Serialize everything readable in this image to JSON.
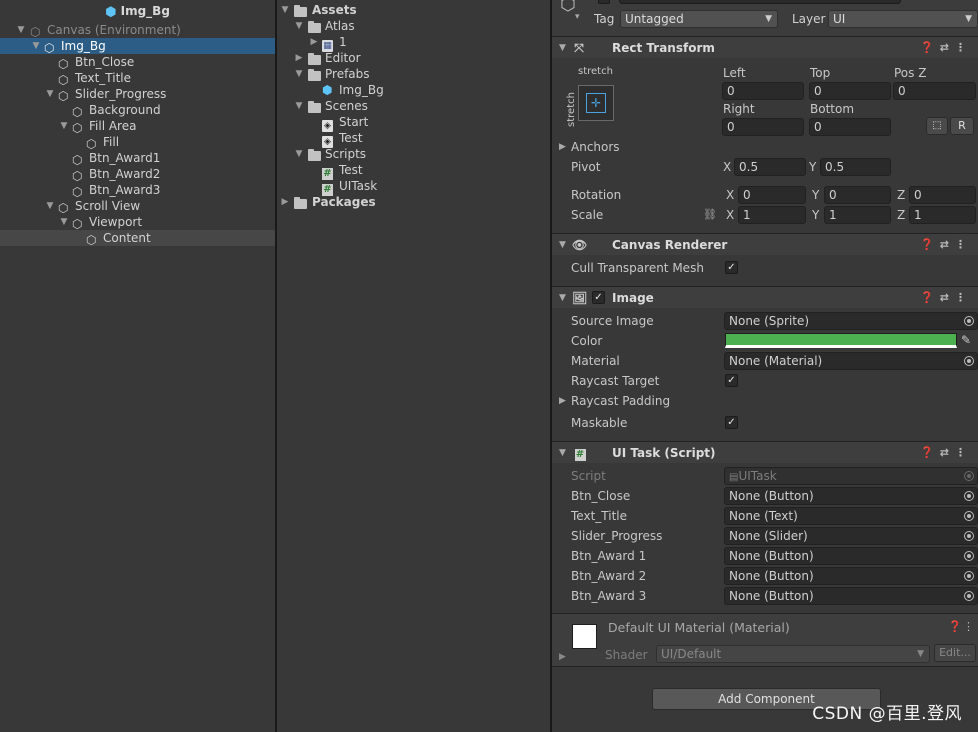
{
  "hierarchy": {
    "title": "Img_Bg",
    "items": [
      {
        "label": "Canvas (Environment)"
      },
      {
        "label": "Img_Bg"
      },
      {
        "label": "Btn_Close"
      },
      {
        "label": "Text_Title"
      },
      {
        "label": "Slider_Progress"
      },
      {
        "label": "Background"
      },
      {
        "label": "Fill Area"
      },
      {
        "label": "Fill"
      },
      {
        "label": "Btn_Award1"
      },
      {
        "label": "Btn_Award2"
      },
      {
        "label": "Btn_Award3"
      },
      {
        "label": "Scroll View"
      },
      {
        "label": "Viewport"
      },
      {
        "label": "Content"
      }
    ]
  },
  "project": {
    "items": [
      {
        "label": "Assets"
      },
      {
        "label": "Atlas"
      },
      {
        "label": "1"
      },
      {
        "label": "Editor"
      },
      {
        "label": "Prefabs"
      },
      {
        "label": "Img_Bg"
      },
      {
        "label": "Scenes"
      },
      {
        "label": "Start"
      },
      {
        "label": "Test"
      },
      {
        "label": "Scripts"
      },
      {
        "label": "Test"
      },
      {
        "label": "UITask"
      },
      {
        "label": "Packages"
      }
    ]
  },
  "inspector": {
    "tag_label": "Tag",
    "tag_value": "Untagged",
    "layer_label": "Layer",
    "layer_value": "UI",
    "rect_transform": {
      "title": "Rect Transform",
      "stretch_top": "stretch",
      "stretch_side": "stretch",
      "left_label": "Left",
      "left": "0",
      "top_label": "Top",
      "top": "0",
      "posz_label": "Pos Z",
      "posz": "0",
      "right_label": "Right",
      "right": "0",
      "bottom_label": "Bottom",
      "bottom": "0",
      "r_button": "R",
      "anchors_label": "Anchors",
      "pivot_label": "Pivot",
      "pivot_x": "0.5",
      "pivot_y": "0.5",
      "rotation_label": "Rotation",
      "rot_x": "0",
      "rot_y": "0",
      "rot_z": "0",
      "scale_label": "Scale",
      "scale_x": "1",
      "scale_y": "1",
      "scale_z": "1",
      "x": "X",
      "y": "Y",
      "z": "Z"
    },
    "canvas_renderer": {
      "title": "Canvas Renderer",
      "cull_label": "Cull Transparent Mesh",
      "cull": true
    },
    "image": {
      "title": "Image",
      "source_label": "Source Image",
      "source": "None (Sprite)",
      "color_label": "Color",
      "color": "#4caf50",
      "material_label": "Material",
      "material": "None (Material)",
      "raycast_target_label": "Raycast Target",
      "raycast_padding_label": "Raycast Padding",
      "maskable_label": "Maskable"
    },
    "ui_task": {
      "title": "UI Task (Script)",
      "script_label": "Script",
      "script": "UITask",
      "fields": [
        {
          "label": "Btn_Close",
          "value": "None (Button)"
        },
        {
          "label": "Text_Title",
          "value": "None (Text)"
        },
        {
          "label": "Slider_Progress",
          "value": "None (Slider)"
        },
        {
          "label": "Btn_Award 1",
          "value": "None (Button)"
        },
        {
          "label": "Btn_Award 2",
          "value": "None (Button)"
        },
        {
          "label": "Btn_Award 3",
          "value": "None (Button)"
        }
      ]
    },
    "material": {
      "title": "Default UI Material (Material)",
      "shader_label": "Shader",
      "shader": "UI/Default",
      "edit": "Edit..."
    },
    "add_component": "Add Component"
  },
  "watermark": "CSDN @百里.登风"
}
